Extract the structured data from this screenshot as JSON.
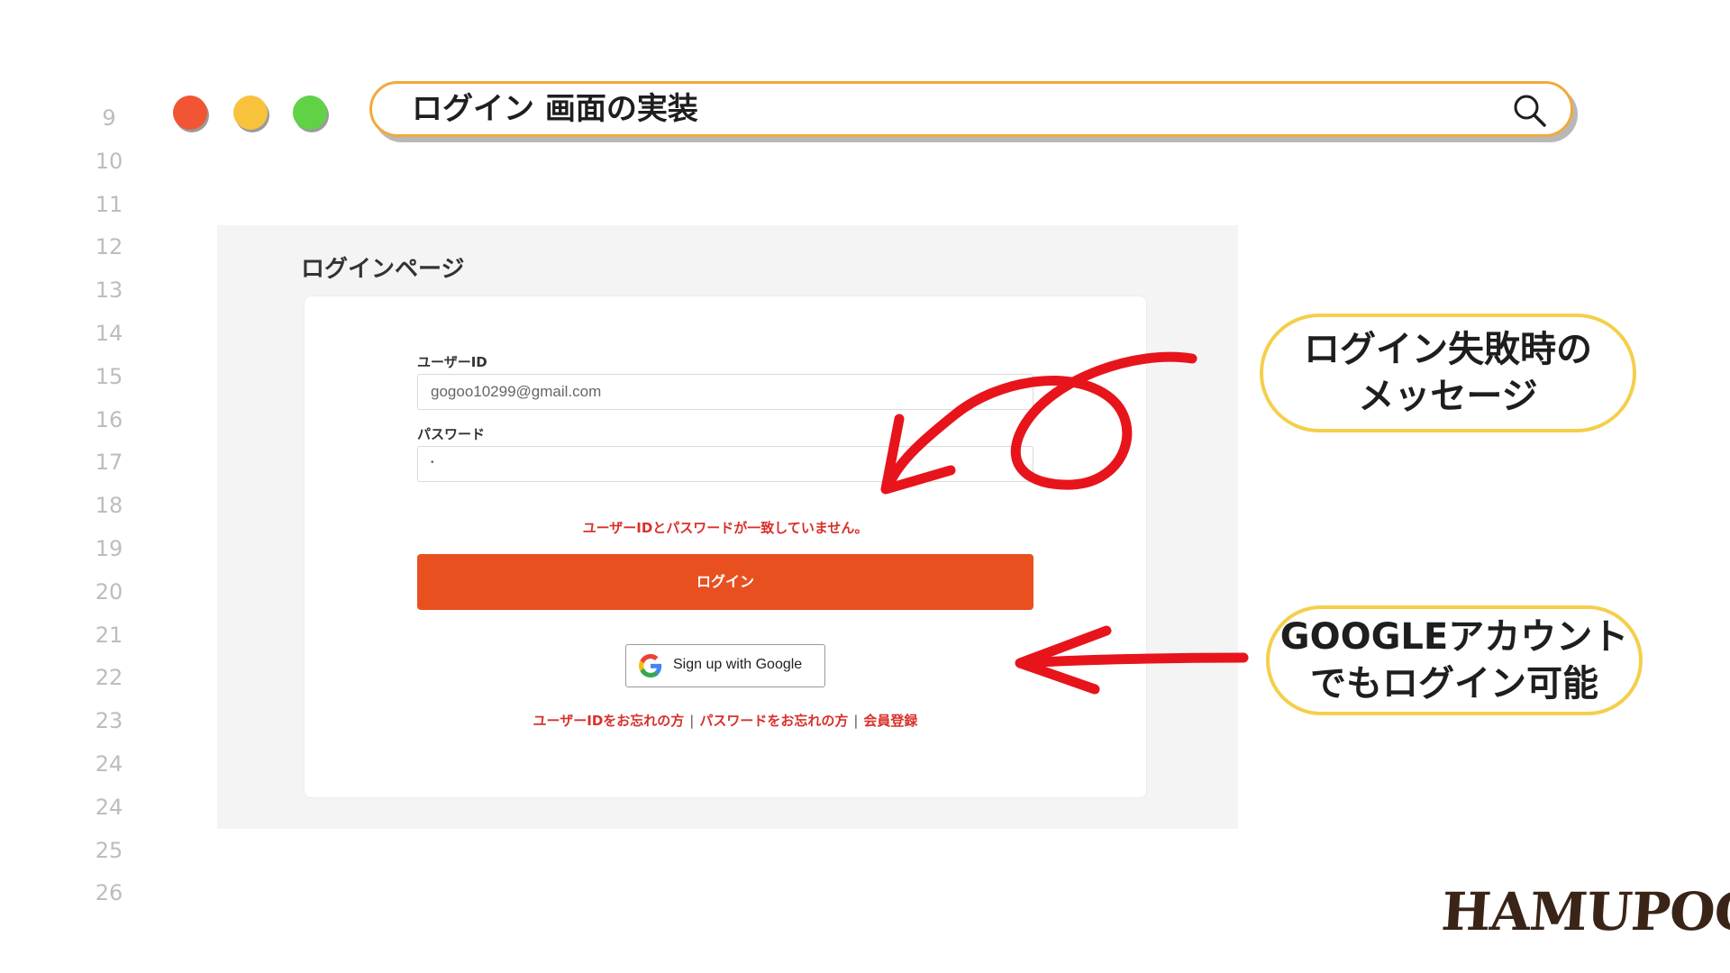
{
  "line_numbers": [
    "9",
    "10",
    "11",
    "12",
    "13",
    "14",
    "15",
    "16",
    "17",
    "18",
    "19",
    "20",
    "21",
    "22",
    "23",
    "24",
    "24",
    "25",
    "26"
  ],
  "window": {
    "search_text": "ログイン 画面の実装",
    "dot_colors": {
      "red": "#f25533",
      "yellow": "#f8c23d",
      "green": "#5fd246"
    }
  },
  "login_page": {
    "title": "ログインページ",
    "user_id_label": "ユーザーID",
    "user_id_value": "gogoo10299@gmail.com",
    "password_label": "パスワード",
    "password_value": "•",
    "error_message": "ユーザーIDとパスワードが一致していません。",
    "login_button": "ログイン",
    "google_button": "Sign up with Google",
    "links": {
      "forgot_id": "ユーザーIDをお忘れの方",
      "forgot_password": "パスワードをお忘れの方",
      "register": "会員登録",
      "separator": "|"
    },
    "accent_color": "#e8501f",
    "error_color": "#d9302b"
  },
  "annotations": {
    "callout_1_line1": "ログイン失敗時の",
    "callout_1_line2": "メッセージ",
    "callout_2_line1": "GOOGLEアカウント",
    "callout_2_line2": "でもログイン可能",
    "annotation_color": "#e8141b"
  },
  "logo": "HAMUPOCHI"
}
